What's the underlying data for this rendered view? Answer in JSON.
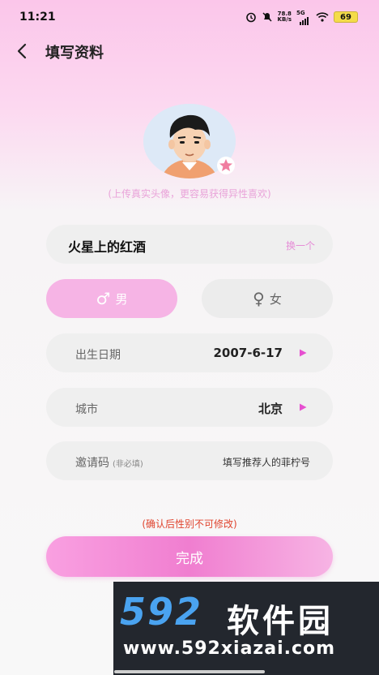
{
  "status": {
    "time": "11:21",
    "speed_top": "78.8",
    "speed_unit": "KB/s",
    "network": "5G",
    "battery": "69"
  },
  "header": {
    "title": "填写资料"
  },
  "avatar": {
    "hint": "(上传真实头像，更容易获得异性喜欢)"
  },
  "nickname": {
    "value": "火星上的红酒",
    "change_label": "换一个"
  },
  "gender": {
    "male_label": "男",
    "female_label": "女",
    "male_symbol": "♂",
    "female_symbol": "♀",
    "selected": "male"
  },
  "birthday": {
    "label": "出生日期",
    "value": "2007-6-17"
  },
  "city": {
    "label": "城市",
    "value": "北京"
  },
  "invite": {
    "label": "邀请码",
    "optional": "(非必填)",
    "placeholder": "填写推荐人的菲柠号"
  },
  "warning": "(确认后性别不可修改)",
  "submit_label": "完成",
  "watermark": {
    "logo_num": "592",
    "logo_text": "软件园",
    "url": "www.592xiazai.com"
  },
  "colors": {
    "accent": "#f07ed0",
    "hint": "#e9a3d9",
    "warning": "#e0442e"
  }
}
